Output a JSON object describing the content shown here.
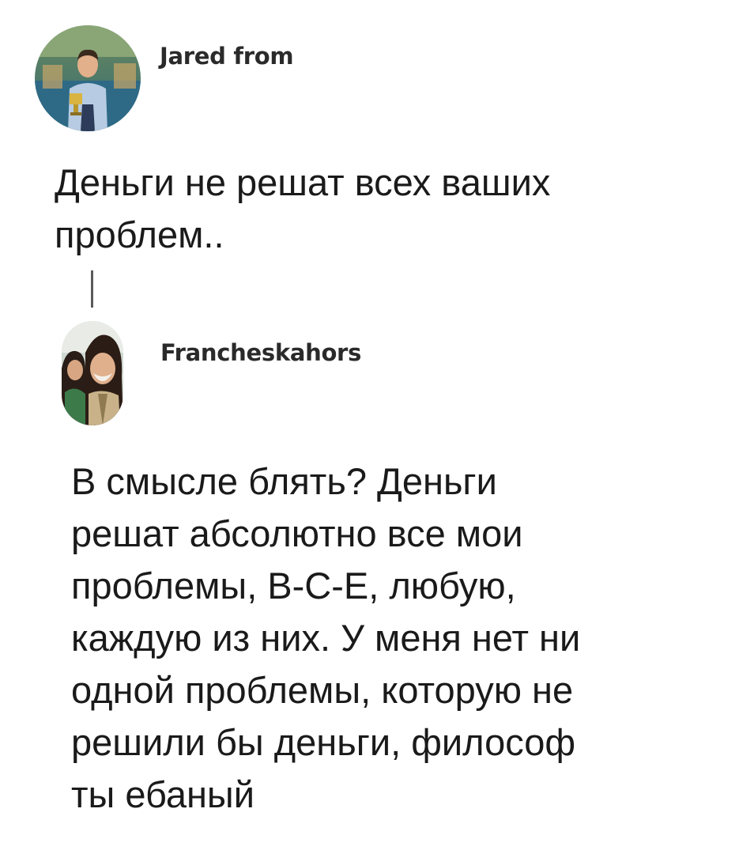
{
  "thread": [
    {
      "author": "Jared from",
      "text_lines": [
        "Деньги не решат всех ваших",
        "проблем.."
      ],
      "avatar": "profile-photo-man-with-trophy"
    },
    {
      "author": "Francheskahors",
      "text_lines": [
        "В смысле блять? Деньги",
        "решат абсолютно все мои",
        "проблемы, В-С-Е, любую,",
        "каждую из них. У меня нет ни",
        "одной проблемы, которую не",
        "решили бы деньги, философ",
        "ты ебаный"
      ],
      "avatar": "profile-photo-two-women"
    }
  ]
}
